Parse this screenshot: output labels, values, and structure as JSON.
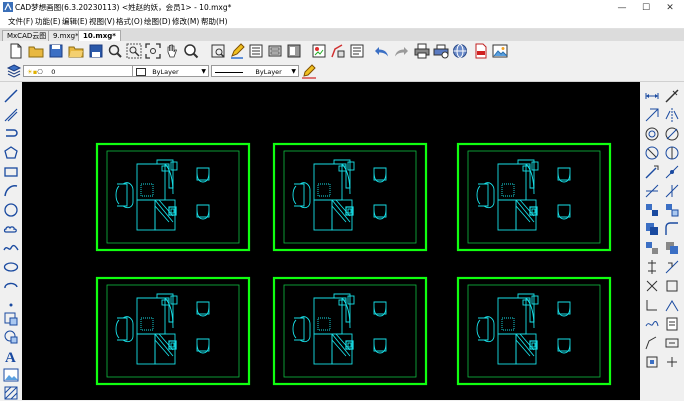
{
  "window": {
    "title": "CAD梦想画图(6.3.20230113) <姓赵的妖，会员1> - 10.mxg*",
    "minimize_icon": "minimize-icon",
    "maximize_icon": "maximize-icon",
    "close_icon": "close-icon"
  },
  "menu": {
    "items": [
      "文件(F)",
      "功能(E)",
      "编辑(E)",
      "视图(V)",
      "格式(O)",
      "绘图(D)",
      "修改(M)",
      "帮助(H)"
    ]
  },
  "tabs": {
    "items": [
      {
        "label": "MxCAD云图",
        "active": false
      },
      {
        "label": "9.mxg*",
        "active": false
      },
      {
        "label": "10.mxg*",
        "active": true
      }
    ]
  },
  "layer_toolbar": {
    "layer_value": "0",
    "color_value": "ByLayer",
    "linetype_value": "ByLayer"
  },
  "toolbar_icons": [
    "new-icon",
    "open-icon",
    "save-icon",
    "zoom-realtime-icon",
    "zoom-window-icon",
    "zoom-extents-icon",
    "pan-hand-icon",
    "zoom-in-icon",
    "measure-icon",
    "pen-icon",
    "layer-manager-icon",
    "properties-icon",
    "block-icon",
    "style-icon",
    "match-icon",
    "undo-icon",
    "redo-icon",
    "print-icon",
    "print-preview-icon",
    "web-icon",
    "pdf-icon",
    "image-icon"
  ],
  "left_tool_icons": [
    "line-icon",
    "polyline-icon",
    "arc-icon",
    "polygon-icon",
    "rectangle-icon",
    "curve-arc-icon",
    "circle-icon",
    "revision-cloud-icon",
    "spline-icon",
    "ellipse-icon",
    "ellipse-arc-icon",
    "insert-block-icon",
    "make-block-icon",
    "point-icon",
    "hatch-icon",
    "region-icon",
    "text-icon",
    "image-insert-icon"
  ],
  "right_tool_icons": [
    "dimension-linear-icon",
    "erase-icon",
    "copy-icon",
    "mirror-icon",
    "offset-icon",
    "array-icon",
    "move-icon",
    "rotate-icon",
    "scale-icon",
    "stretch-icon",
    "trim-icon",
    "extend-icon",
    "break-icon",
    "join-icon",
    "chamfer-icon",
    "fillet-icon",
    "explode-icon",
    "lengthen-icon"
  ],
  "drawing": {
    "background": "#000000",
    "frame_color": "#1aff1a",
    "inner_frame_color": "#00cc44",
    "furniture_color": "#18e0e8",
    "block_count": 6
  }
}
